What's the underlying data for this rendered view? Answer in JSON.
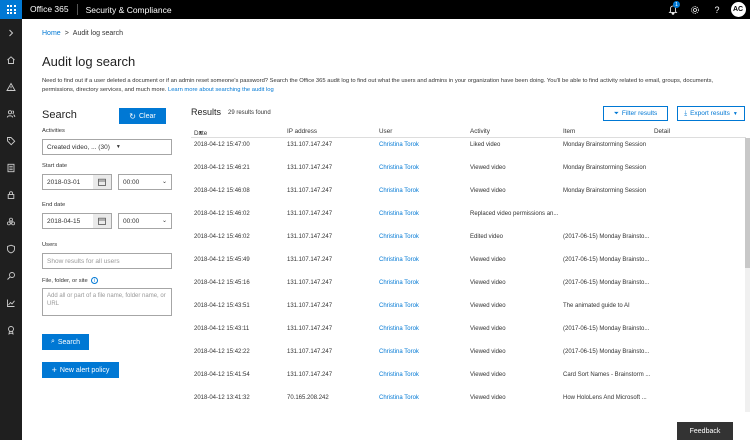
{
  "topbar": {
    "brand": "Office 365",
    "app_name": "Security & Compliance",
    "notification_count": "1",
    "avatar_initials": "AC"
  },
  "breadcrumb": {
    "home": "Home",
    "separator": ">",
    "current": "Audit log search"
  },
  "page_title": "Audit log search",
  "description": {
    "text": "Need to find out if a user deleted a document or if an admin reset someone's password? Search the Office 365 audit log to find out what the users and admins in your organization have been doing. You'll be able to find activity related to email, groups, documents, permissions, directory services, and much more.",
    "link": "Learn more about searching the audit log"
  },
  "search": {
    "heading": "Search",
    "clear_label": "Clear",
    "activities_label": "Activities",
    "activities_value": "Created video, ... (30)",
    "start_date_label": "Start date",
    "start_date": "2018-03-01",
    "start_time": "00:00",
    "end_date_label": "End date",
    "end_date": "2018-04-15",
    "end_time": "00:00",
    "users_label": "Users",
    "users_placeholder": "Show results for all users",
    "file_label": "File, folder, or site",
    "file_placeholder": "Add all or part of a file name, folder name, or URL",
    "search_button": "Search",
    "new_alert_button": "New alert policy"
  },
  "results": {
    "heading": "Results",
    "count": "29 results found",
    "filter_button": "Filter results",
    "export_button": "Export results",
    "columns": [
      "Date",
      "IP address",
      "User",
      "Activity",
      "Item",
      "Detail"
    ],
    "rows": [
      {
        "date": "2018-04-12 15:47:00",
        "ip": "131.107.147.247",
        "user": "Christina Torok",
        "activity": "Liked video",
        "item": "Monday Brainstorming Session",
        "detail": ""
      },
      {
        "date": "2018-04-12 15:46:21",
        "ip": "131.107.147.247",
        "user": "Christina Torok",
        "activity": "Viewed video",
        "item": "Monday Brainstorming Session",
        "detail": ""
      },
      {
        "date": "2018-04-12 15:46:08",
        "ip": "131.107.147.247",
        "user": "Christina Torok",
        "activity": "Viewed video",
        "item": "Monday Brainstorming Session",
        "detail": ""
      },
      {
        "date": "2018-04-12 15:46:02",
        "ip": "131.107.147.247",
        "user": "Christina Torok",
        "activity": "Replaced video permissions an...",
        "item": "",
        "detail": ""
      },
      {
        "date": "2018-04-12 15:46:02",
        "ip": "131.107.147.247",
        "user": "Christina Torok",
        "activity": "Edited video",
        "item": "(2017-06-15) Monday Brainsto...",
        "detail": ""
      },
      {
        "date": "2018-04-12 15:45:49",
        "ip": "131.107.147.247",
        "user": "Christina Torok",
        "activity": "Viewed video",
        "item": "(2017-06-15) Monday Brainsto...",
        "detail": ""
      },
      {
        "date": "2018-04-12 15:45:16",
        "ip": "131.107.147.247",
        "user": "Christina Torok",
        "activity": "Viewed video",
        "item": "(2017-06-15) Monday Brainsto...",
        "detail": ""
      },
      {
        "date": "2018-04-12 15:43:51",
        "ip": "131.107.147.247",
        "user": "Christina Torok",
        "activity": "Viewed video",
        "item": "The animated guide to AI",
        "detail": ""
      },
      {
        "date": "2018-04-12 15:43:11",
        "ip": "131.107.147.247",
        "user": "Christina Torok",
        "activity": "Viewed video",
        "item": "(2017-06-15) Monday Brainsto...",
        "detail": ""
      },
      {
        "date": "2018-04-12 15:42:22",
        "ip": "131.107.147.247",
        "user": "Christina Torok",
        "activity": "Viewed video",
        "item": "(2017-06-15) Monday Brainsto...",
        "detail": ""
      },
      {
        "date": "2018-04-12 15:41:54",
        "ip": "131.107.147.247",
        "user": "Christina Torok",
        "activity": "Viewed video",
        "item": "Card Sort Names - Brainstorm ...",
        "detail": ""
      },
      {
        "date": "2018-04-12 13:41:32",
        "ip": "70.165.208.242",
        "user": "Christina Torok",
        "activity": "Viewed video",
        "item": "How HoloLens And Microsoft ...",
        "detail": ""
      }
    ]
  },
  "feedback_label": "Feedback",
  "colors": {
    "accent": "#0078d4",
    "topbar": "#000000",
    "rail": "#1f1f1f"
  }
}
